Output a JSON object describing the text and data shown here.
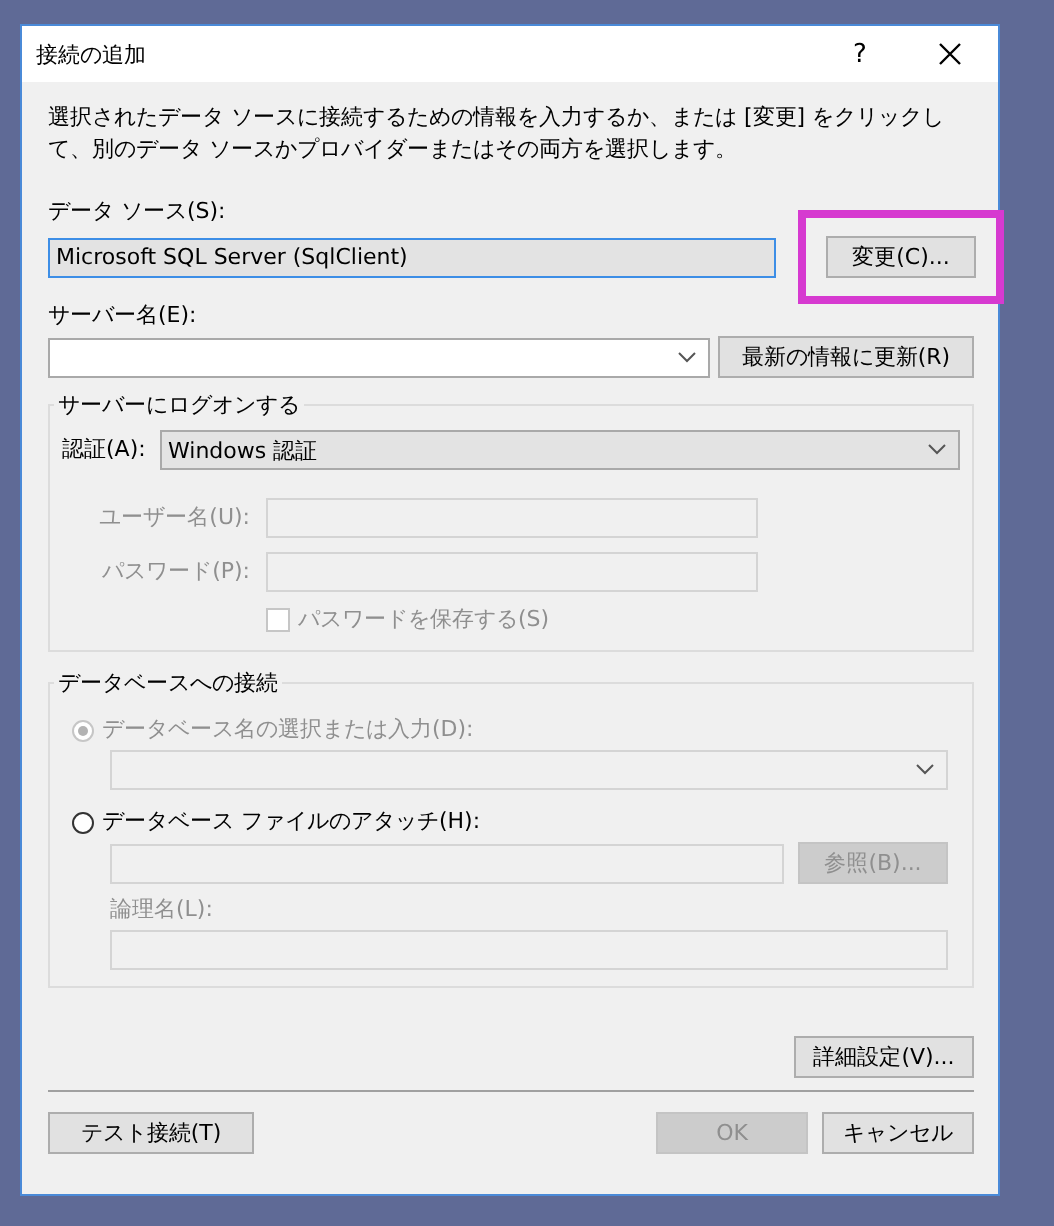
{
  "window": {
    "title": "接続の追加",
    "help": "?"
  },
  "description": "選択されたデータ ソースに接続するための情報を入力するか、または [変更] をクリックして、別のデータ ソースかプロバイダーまたはその両方を選択します。",
  "data_source": {
    "label": "データ ソース(S):",
    "value": "Microsoft SQL Server (SqlClient)"
  },
  "change_button": {
    "label": "変更(C)...",
    "highlighted": true
  },
  "server": {
    "label": "サーバー名(E):"
  },
  "refresh_button": {
    "label": "最新の情報に更新(R)"
  },
  "logon_group": {
    "title": "サーバーにログオンする",
    "auth_label": "認証(A):",
    "auth_value": "Windows 認証",
    "fields": [
      {
        "label": "ユーザー名(U):",
        "disabled": true
      },
      {
        "label": "パスワード(P):",
        "disabled": true
      }
    ],
    "save_password": {
      "label": "パスワードを保存する(S)",
      "checked": false,
      "disabled": true
    }
  },
  "db_group": {
    "title": "データベースへの接続",
    "options": [
      {
        "label": "データベース名の選択または入力(D):",
        "selected": true,
        "disabled": true
      },
      {
        "label": "データベース ファイルのアタッチ(H):",
        "selected": false,
        "disabled": false
      }
    ],
    "browse_button": {
      "label": "参照(B)...",
      "disabled": true
    },
    "logical_name": {
      "label": "論理名(L):",
      "disabled": true
    }
  },
  "advanced_button": {
    "label": "詳細設定(V)..."
  },
  "test_button": {
    "label": "テスト接続(T)"
  },
  "ok_button": {
    "label": "OK",
    "disabled": true
  },
  "cancel_button": {
    "label": "キャンセル",
    "disabled": false
  }
}
